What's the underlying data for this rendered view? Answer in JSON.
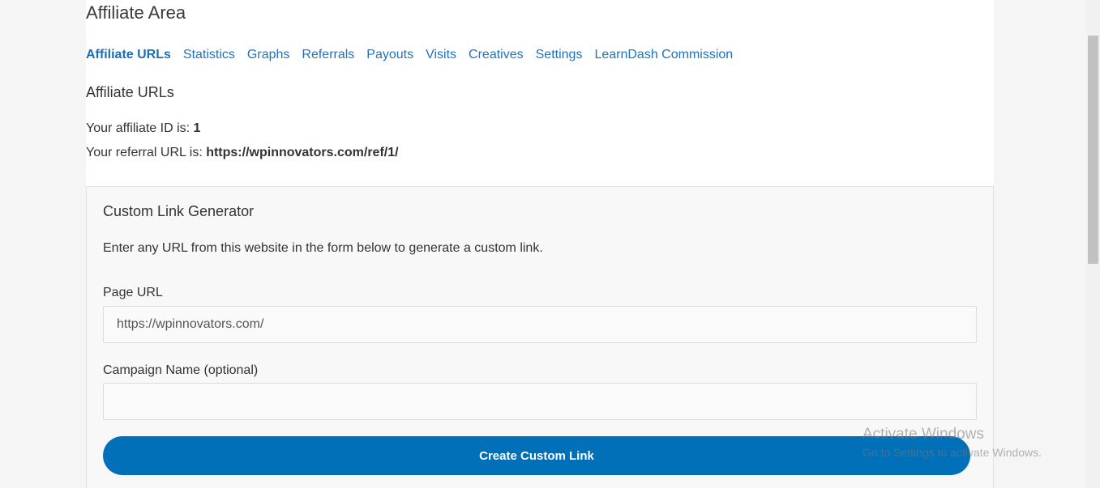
{
  "page": {
    "title": "Affiliate Area"
  },
  "tabs": [
    {
      "label": "Affiliate URLs",
      "active": true
    },
    {
      "label": "Statistics"
    },
    {
      "label": "Graphs"
    },
    {
      "label": "Referrals"
    },
    {
      "label": "Payouts"
    },
    {
      "label": "Visits"
    },
    {
      "label": "Creatives"
    },
    {
      "label": "Settings"
    },
    {
      "label": "LearnDash Commission"
    }
  ],
  "section": {
    "title": "Affiliate URLs",
    "id_label": "Your affiliate ID is: ",
    "id_value": "1",
    "url_label": "Your referral URL is: ",
    "url_value": "https://wpinnovators.com/ref/1/"
  },
  "generator": {
    "title": "Custom Link Generator",
    "description": "Enter any URL from this website in the form below to generate a custom link.",
    "page_url_label": "Page URL",
    "page_url_value": "https://wpinnovators.com/",
    "campaign_label": "Campaign Name (optional)",
    "campaign_value": "",
    "button_label": "Create Custom Link"
  },
  "watermark": {
    "title": "Activate Windows",
    "subtitle": "Go to Settings to activate Windows."
  },
  "colors": {
    "accent": "#0170b9",
    "link": "#1e73be"
  }
}
